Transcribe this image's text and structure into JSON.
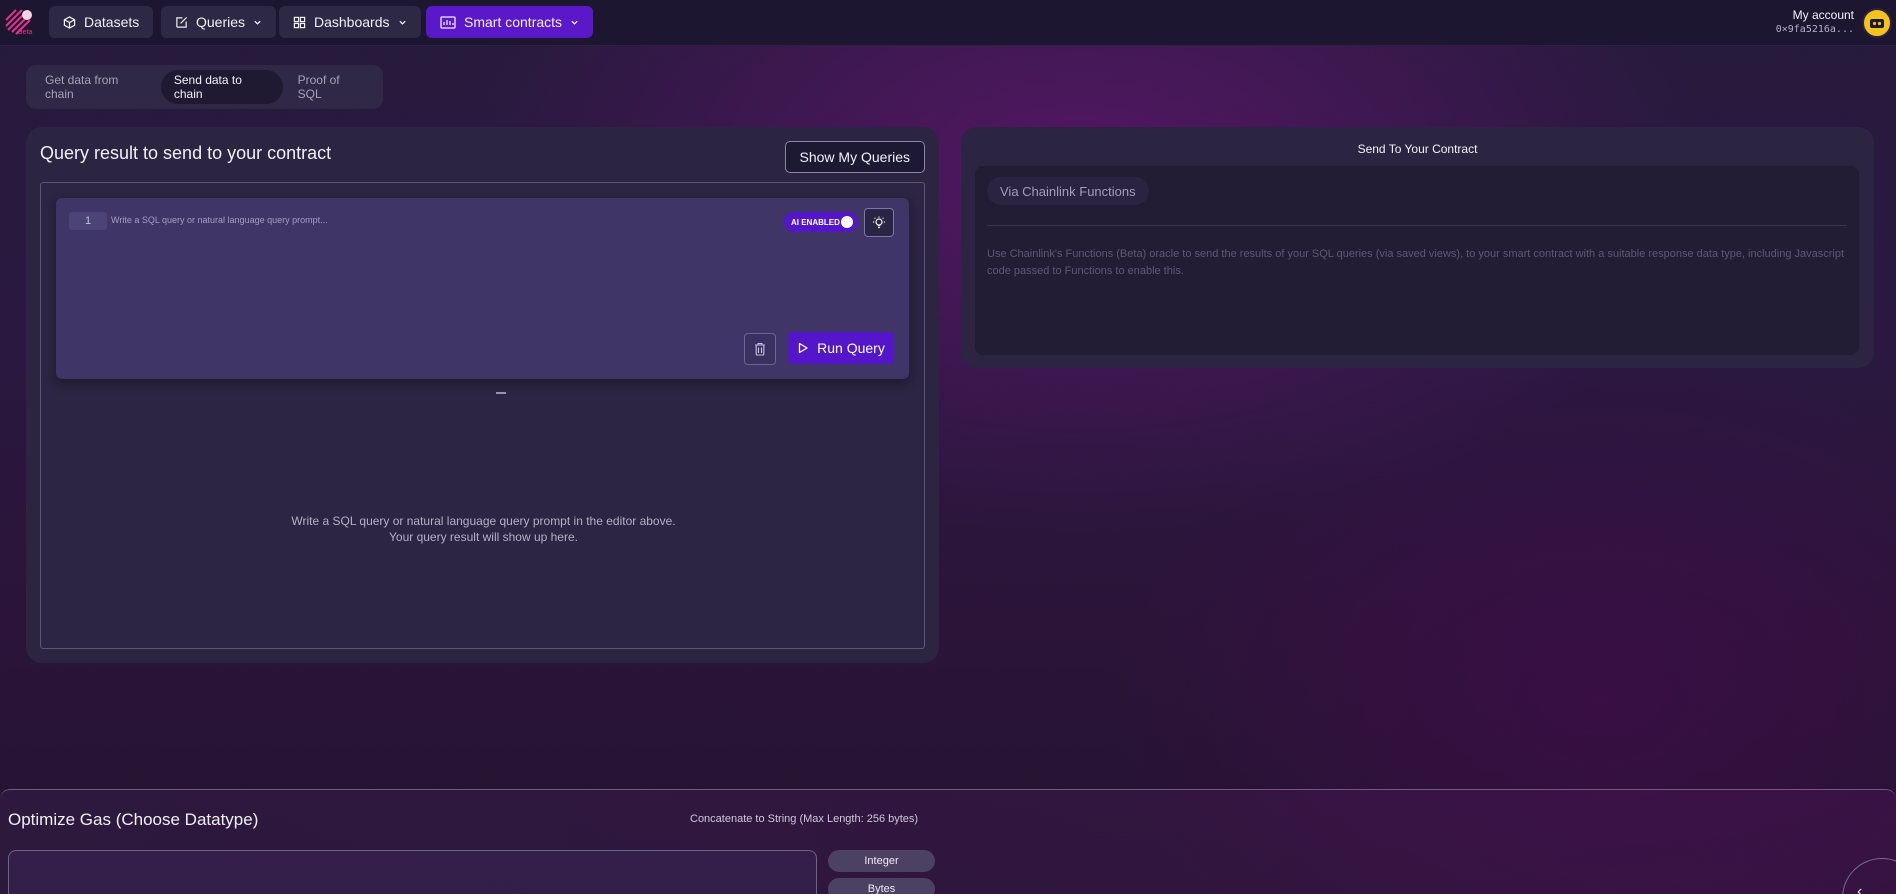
{
  "nav": {
    "logo_badge": "Beta",
    "datasets": "Datasets",
    "queries": "Queries",
    "dashboards": "Dashboards",
    "smart_contracts": "Smart contracts",
    "account_label": "My account",
    "account_address": "0×9fa5216a..."
  },
  "tabs": [
    "Get data from chain",
    "Send data to chain",
    "Proof of SQL"
  ],
  "left_panel": {
    "title": "Query result to send to your contract",
    "show_queries": "Show My Queries",
    "line_number": "1",
    "editor_placeholder": "Write a SQL query or natural language query prompt...",
    "ai_toggle": "AI ENABLED",
    "run_query": "Run Query",
    "result_line1": "Write a SQL query or natural language query prompt in the editor above.",
    "result_line2": "Your query result will show up here."
  },
  "right_panel": {
    "title": "Send To Your Contract",
    "method": "Via Chainlink Functions",
    "description": "Use Chainlink's Functions (Beta) oracle to send the results of your SQL queries (via saved views), to your smart contract with a suitable response data type, including Javascript code passed to Functions to enable this."
  },
  "bottom": {
    "title": "Optimize Gas (Choose Datatype)",
    "concat_label": "Concatenate to String (Max Length: 256 bytes)",
    "types": [
      "Integer",
      "Bytes"
    ]
  },
  "colors": {
    "accent": "#5316c8",
    "panel": "#2b2541",
    "editor": "#3f3566"
  }
}
